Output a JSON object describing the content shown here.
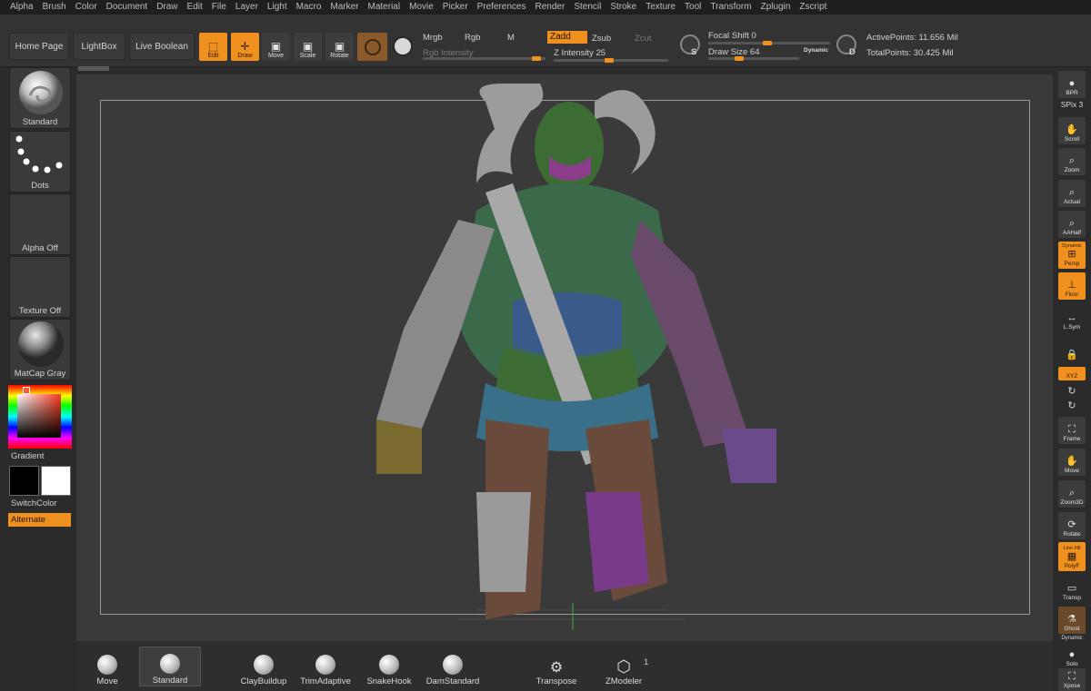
{
  "menu": [
    "Alpha",
    "Brush",
    "Color",
    "Document",
    "Draw",
    "Edit",
    "File",
    "Layer",
    "Light",
    "Macro",
    "Marker",
    "Material",
    "Movie",
    "Picker",
    "Preferences",
    "Render",
    "Stencil",
    "Stroke",
    "Texture",
    "Tool",
    "Transform",
    "Zplugin",
    "Zscript"
  ],
  "shelf": {
    "home_page": "Home Page",
    "lightbox": "LightBox",
    "live_boolean": "Live Boolean",
    "edit": "Edit",
    "draw": "Draw",
    "move": "Move",
    "scale": "Scale",
    "rotate": "Rotate",
    "mrgb": "Mrgb",
    "rgb": "Rgb",
    "m": "M",
    "rgb_intensity": "Rgb Intensity",
    "zadd": "Zadd",
    "zsub": "Zsub",
    "zcut": "Zcut",
    "z_intensity": "Z Intensity 25",
    "focal_shift": "Focal Shift 0",
    "draw_size": "Draw Size 64",
    "dynamic": "Dynamic",
    "active_points": "ActivePoints: 11.656 Mil",
    "total_points": "TotalPoints: 30.425 Mil",
    "s_key": "S",
    "d_key": "D"
  },
  "left": {
    "brush": "Standard",
    "stroke": "Dots",
    "alpha": "Alpha Off",
    "texture": "Texture Off",
    "material": "MatCap Gray",
    "gradient": "Gradient",
    "switch_color": "SwitchColor",
    "alternate": "Alternate"
  },
  "right": {
    "bpr": "BPR",
    "spix": "SPix 3",
    "scroll": "Scroll",
    "zoom": "Zoom",
    "actual": "Actual",
    "aahalf": "AAHalf",
    "dynamic_top": "Dynamic",
    "persp": "Persp",
    "floor": "Floor",
    "lsym": "L.Sym",
    "xyz": "XYZ",
    "frame": "Frame",
    "move": "Move",
    "zoom3d": "Zoom3D",
    "rotate": "Rotate",
    "line_fill": "Line Fill",
    "polyf": "PolyF",
    "transp": "Transp",
    "ghost": "Ghost",
    "dynamic_solo": "Dynamic",
    "solo": "Solo",
    "xpose": "Xpose"
  },
  "bottom": {
    "brushes": [
      "Move",
      "Standard",
      "ClayBuildup",
      "TrimAdaptive",
      "SnakeHook",
      "DamStandard"
    ],
    "transpose": "Transpose",
    "zmodeler": "ZModeler",
    "zmodeler_badge": "1"
  },
  "colors": {
    "accent": "#f0901e",
    "bg": "#2b2b2b",
    "canvas": "#3a3a3a"
  }
}
